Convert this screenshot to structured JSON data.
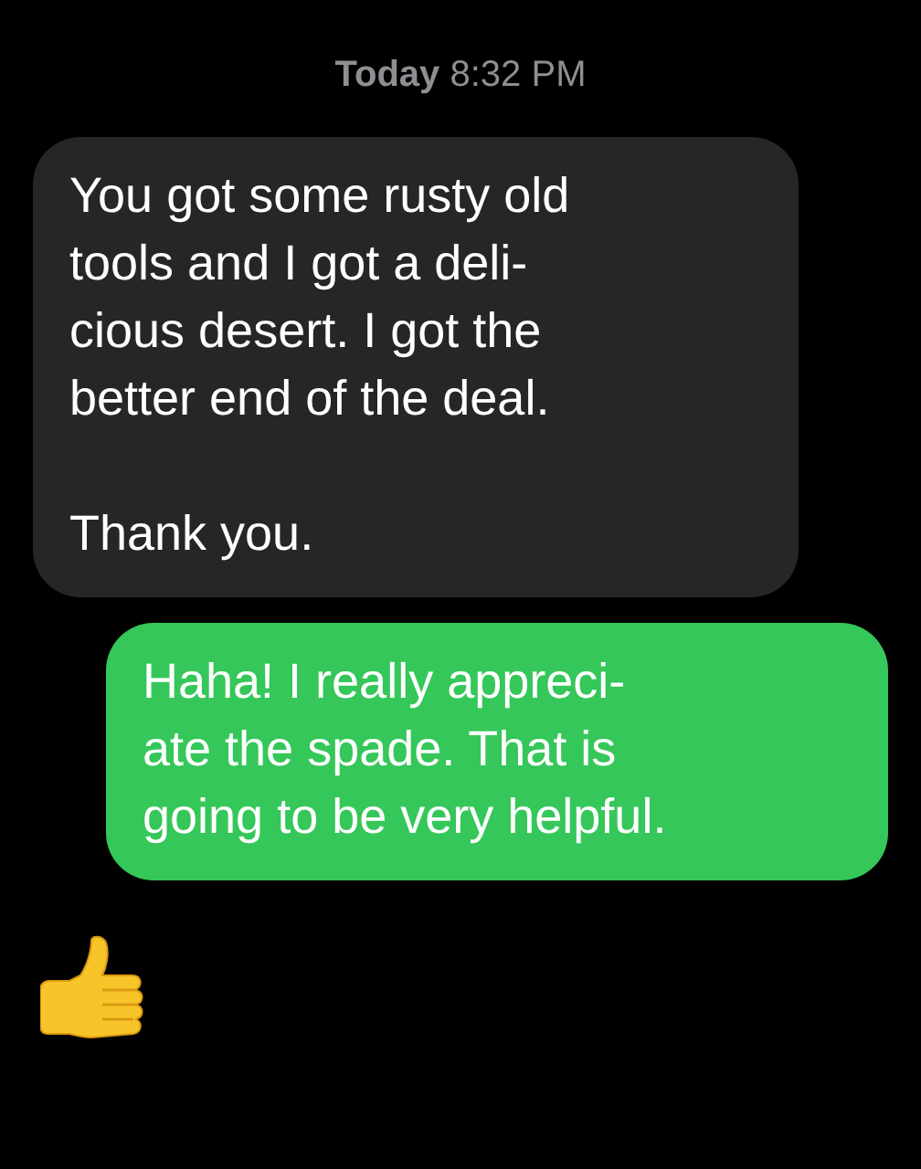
{
  "timestamp": "**Today** 8:32 PM",
  "messages": [
    {
      "kind": "incoming",
      "text": "You got some rusty old\ntools and I got a deli-\ncious desert. I got the\nbetter end of the deal.\n\nThank you."
    },
    {
      "kind": "outgoing",
      "text": "Haha! I really appreci-\nate the spade. That is\ngoing to be very helpful."
    },
    {
      "kind": "emoji"
    }
  ]
}
